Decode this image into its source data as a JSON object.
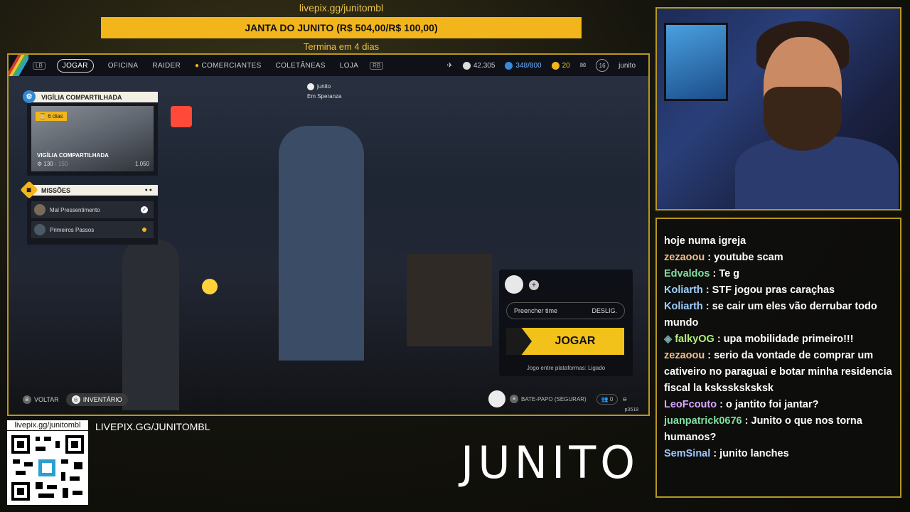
{
  "overlay": {
    "donation_url": "livepix.gg/junitombl",
    "goal_text": "JANTA DO JUNITO (R$ 504,00/R$ 100,00)",
    "goal_remaining": "Termina em 4 dias",
    "qr_url": "livepix.gg/junitombl",
    "livepix_banner": "LIVEPIX.GG/JUNITOMBL",
    "logo_text": "JUNITO"
  },
  "game": {
    "nav": {
      "lb_key": "LB",
      "rb_key": "RB",
      "items": [
        "JOGAR",
        "OFICINA",
        "RAIDER",
        "COMERCIANTES",
        "COLETÂNEAS",
        "LOJA"
      ],
      "active_index": 0
    },
    "currencies": {
      "coins": "42.305",
      "credits": "348/800",
      "tokens": "20",
      "level": "16",
      "username": "junito"
    },
    "player_tag": {
      "name": "junito",
      "location": "Em Speranza"
    },
    "vigil": {
      "header": "VIGÍLIA COMPARTILHADA",
      "days_left": "6 dias",
      "card_title": "VIGÍLIA COMPARTILHADA",
      "progress_current": "130",
      "progress_next": "150",
      "progress_max": "1.050"
    },
    "missions": {
      "header": "MISSÕES",
      "items": [
        {
          "label": "Mal Pressentimento"
        },
        {
          "label": "Primeiros Passos"
        }
      ]
    },
    "squad": {
      "fill_team_label": "Preencher time",
      "fill_team_value": "DESLIG.",
      "play_label": "JOGAR",
      "crossplay_text": "Jogo entre plataformas: Ligado"
    },
    "bottom": {
      "back_key": "B",
      "back_label": "VOLTAR",
      "inventory_label": "INVENTÁRIO",
      "chat_label": "BATE-PAPO (SEGURAR)",
      "friends_count": "0",
      "build": "p3518"
    }
  },
  "chat": {
    "messages": [
      {
        "user": "",
        "text": "hoje numa igreja",
        "color": "#ffffff"
      },
      {
        "user": "zezaoou",
        "text": "youtube scam",
        "color": "#f0c090"
      },
      {
        "user": "Edvaldos",
        "text": "Te g",
        "color": "#7fe0a0"
      },
      {
        "user": "Koliarth",
        "text": "STF jogou pras caraçhas",
        "color": "#a0d0ff"
      },
      {
        "user": "Koliarth",
        "text": "se cair um eles vão derrubar todo mundo",
        "color": "#a0d0ff"
      },
      {
        "user": "falkyOG",
        "text": "upa mobilidade primeiro!!!",
        "color": "#b0f07a"
      },
      {
        "user": "zezaoou",
        "text": "serio da vontade de comprar um cativeiro no paraguai e botar minha residencia fiscal la kskssksksksk",
        "color": "#f0c090"
      },
      {
        "user": "LeoFcouto",
        "text": "o jantito foi jantar?",
        "color": "#d6a8ff"
      },
      {
        "user": "juanpatrick0676",
        "text": "Junito o que nos torna humanos?",
        "color": "#7fe0a0"
      },
      {
        "user": "SemSinal",
        "text": "junito lanches",
        "color": "#a0c8ff"
      }
    ]
  },
  "colors": {
    "accent": "#f2b61c",
    "frame": "#b8971f"
  }
}
